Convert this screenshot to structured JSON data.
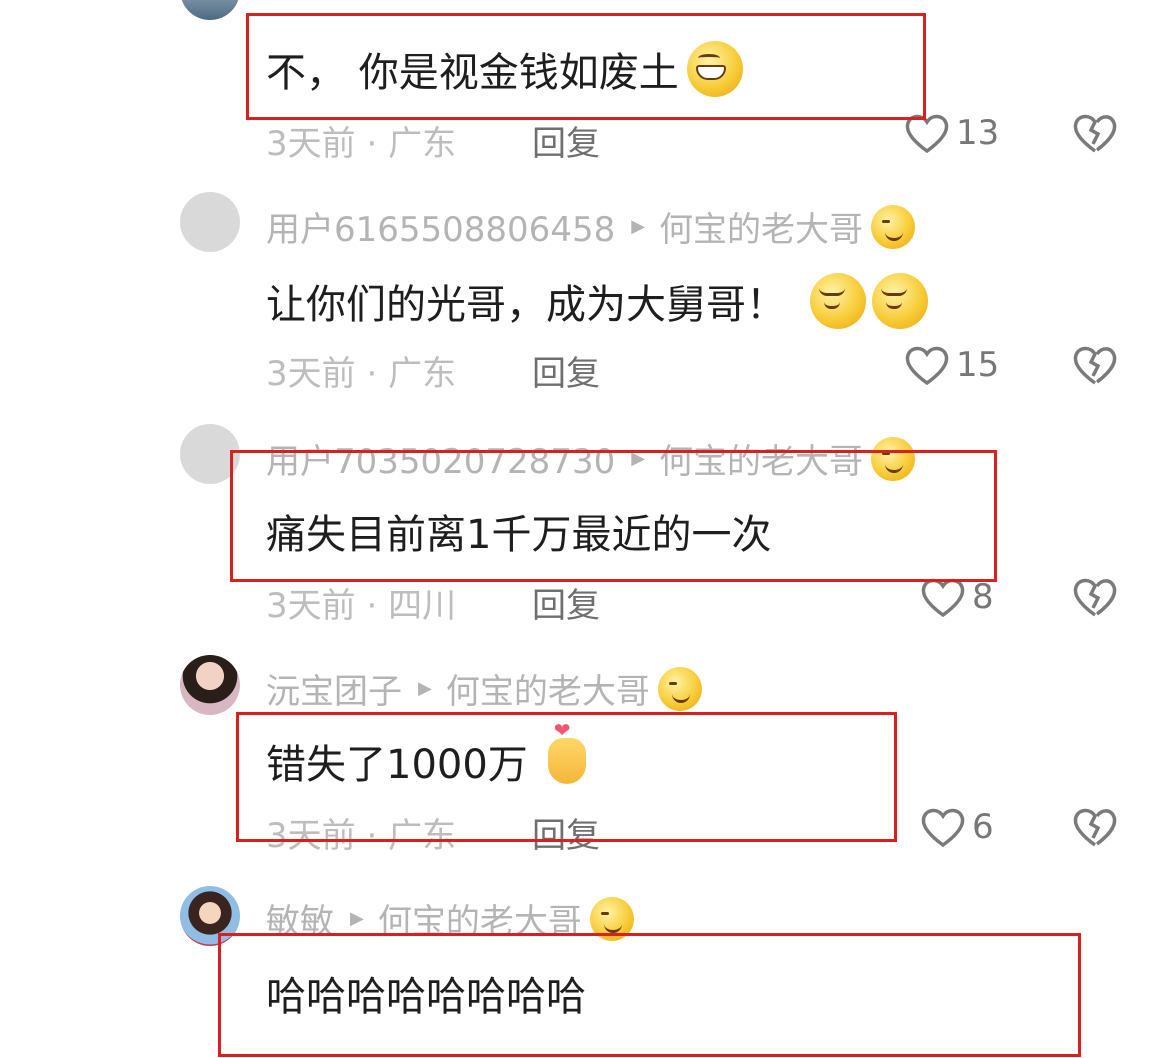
{
  "comments": [
    {
      "user": "",
      "reply_to": "",
      "text": "不， 你是视金钱如废土",
      "time": "3天前",
      "location": "广东",
      "reply_label": "回复",
      "likes": "13"
    },
    {
      "user": "用户6165508806458",
      "reply_to": "何宝的老大哥",
      "text": "让你们的光哥，成为大舅哥！",
      "time": "3天前",
      "location": "广东",
      "reply_label": "回复",
      "likes": "15"
    },
    {
      "user": "用户7035020728730",
      "reply_to": "何宝的老大哥",
      "text": "痛失目前离1千万最近的一次",
      "time": "3天前",
      "location": "四川",
      "reply_label": "回复",
      "likes": "8"
    },
    {
      "user": "沅宝团子",
      "reply_to": "何宝的老大哥",
      "text": "错失了1000万",
      "time": "3天前",
      "location": "广东",
      "reply_label": "回复",
      "likes": "6"
    },
    {
      "user": "敏敏",
      "reply_to": "何宝的老大哥",
      "text": "哈哈哈哈哈哈哈哈",
      "time": "",
      "location": "",
      "reply_label": "",
      "likes": ""
    }
  ],
  "meta_separator": "·",
  "highlight_color": "#d9201f"
}
